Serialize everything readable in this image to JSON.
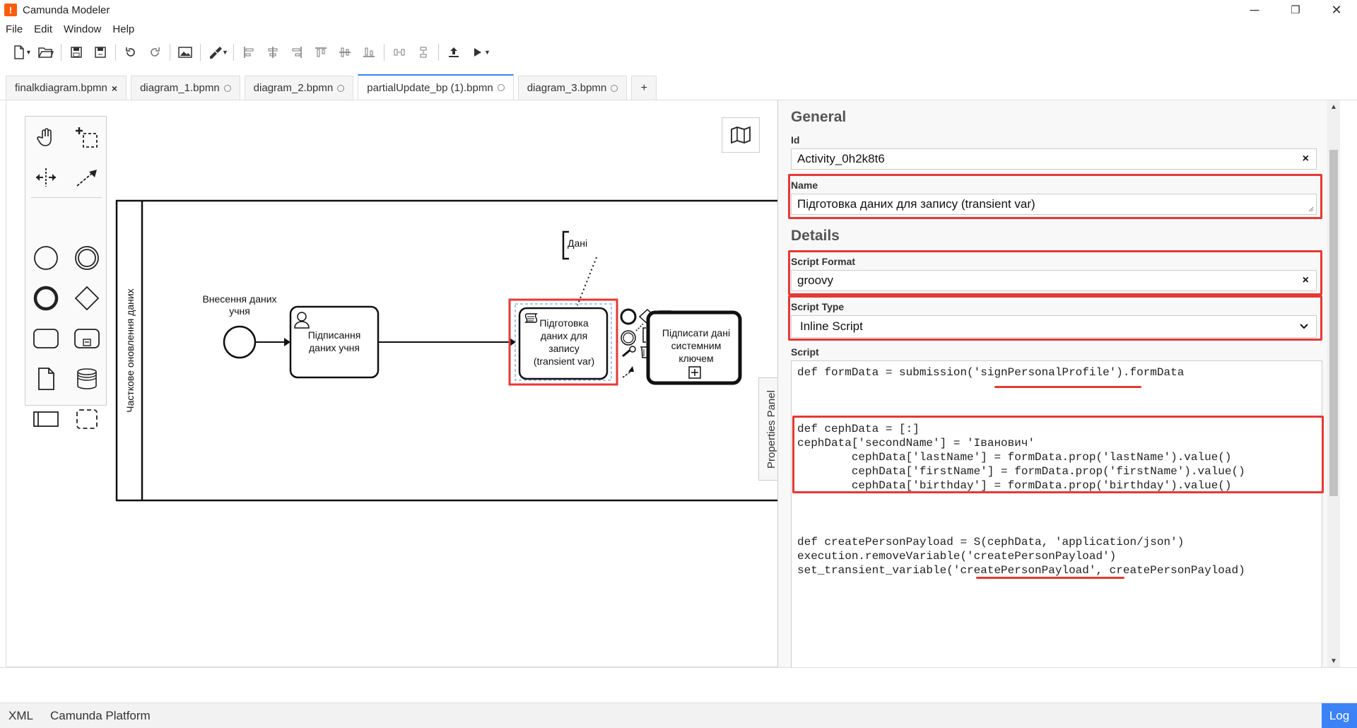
{
  "window": {
    "title": "Camunda Modeler",
    "logo": "!",
    "minimize": "─",
    "restore": "❐",
    "close": "✕"
  },
  "menu": [
    "File",
    "Edit",
    "Window",
    "Help"
  ],
  "tabs": [
    {
      "label": "finalkdiagram.bpmn",
      "state": "close"
    },
    {
      "label": "diagram_1.bpmn",
      "state": "dot"
    },
    {
      "label": "diagram_2.bpmn",
      "state": "dot"
    },
    {
      "label": "partialUpdate_bp (1).bpmn",
      "state": "dot",
      "active": true
    },
    {
      "label": "diagram_3.bpmn",
      "state": "dot"
    }
  ],
  "tabs_add": "+",
  "diagram": {
    "pool_label": "Часткове оновлення даних",
    "start_event_label_1": "Внесення даних",
    "start_event_label_2": "учня",
    "task1_line1": "Підписання",
    "task1_line2": "даних учня",
    "task2_line1": "Підготовка",
    "task2_line2": "даних для",
    "task2_line3": "запису",
    "task2_line4": "(transient var)",
    "annotation": "Дані",
    "task3_line1": "Підписати дані",
    "task3_line2": "системним",
    "task3_line3": "ключем"
  },
  "properties_toggle": "Properties Panel",
  "panel": {
    "general_title": "General",
    "id_label": "Id",
    "id_value": "Activity_0h2k8t6",
    "name_label": "Name",
    "name_value": "Підготовка даних для запису (transient var)",
    "details_title": "Details",
    "script_format_label": "Script Format",
    "script_format_value": "groovy",
    "script_type_label": "Script Type",
    "script_type_value": "Inline Script",
    "script_label": "Script",
    "clear": "×",
    "script_line1": "def formData = submission('signPersonalProfile').formData",
    "script_block2": "def cephData = [:]\ncephData['secondName'] = 'Іванович'\n        cephData['lastName'] = formData.prop('lastName').value()\n        cephData['firstName'] = formData.prop('firstName').value()\n        cephData['birthday'] = formData.prop('birthday').value()",
    "script_block3": "def createPersonPayload = S(cephData, 'application/json')\nexecution.removeVariable('createPersonPayload')\nset_transient_variable('createPersonPayload', createPersonPayload)"
  },
  "status": {
    "xml": "XML",
    "platform": "Camunda Platform",
    "log": "Log"
  },
  "colors": {
    "accent": "#3b82f6",
    "highlight": "#e53935",
    "brand": "#fc5d0d"
  }
}
